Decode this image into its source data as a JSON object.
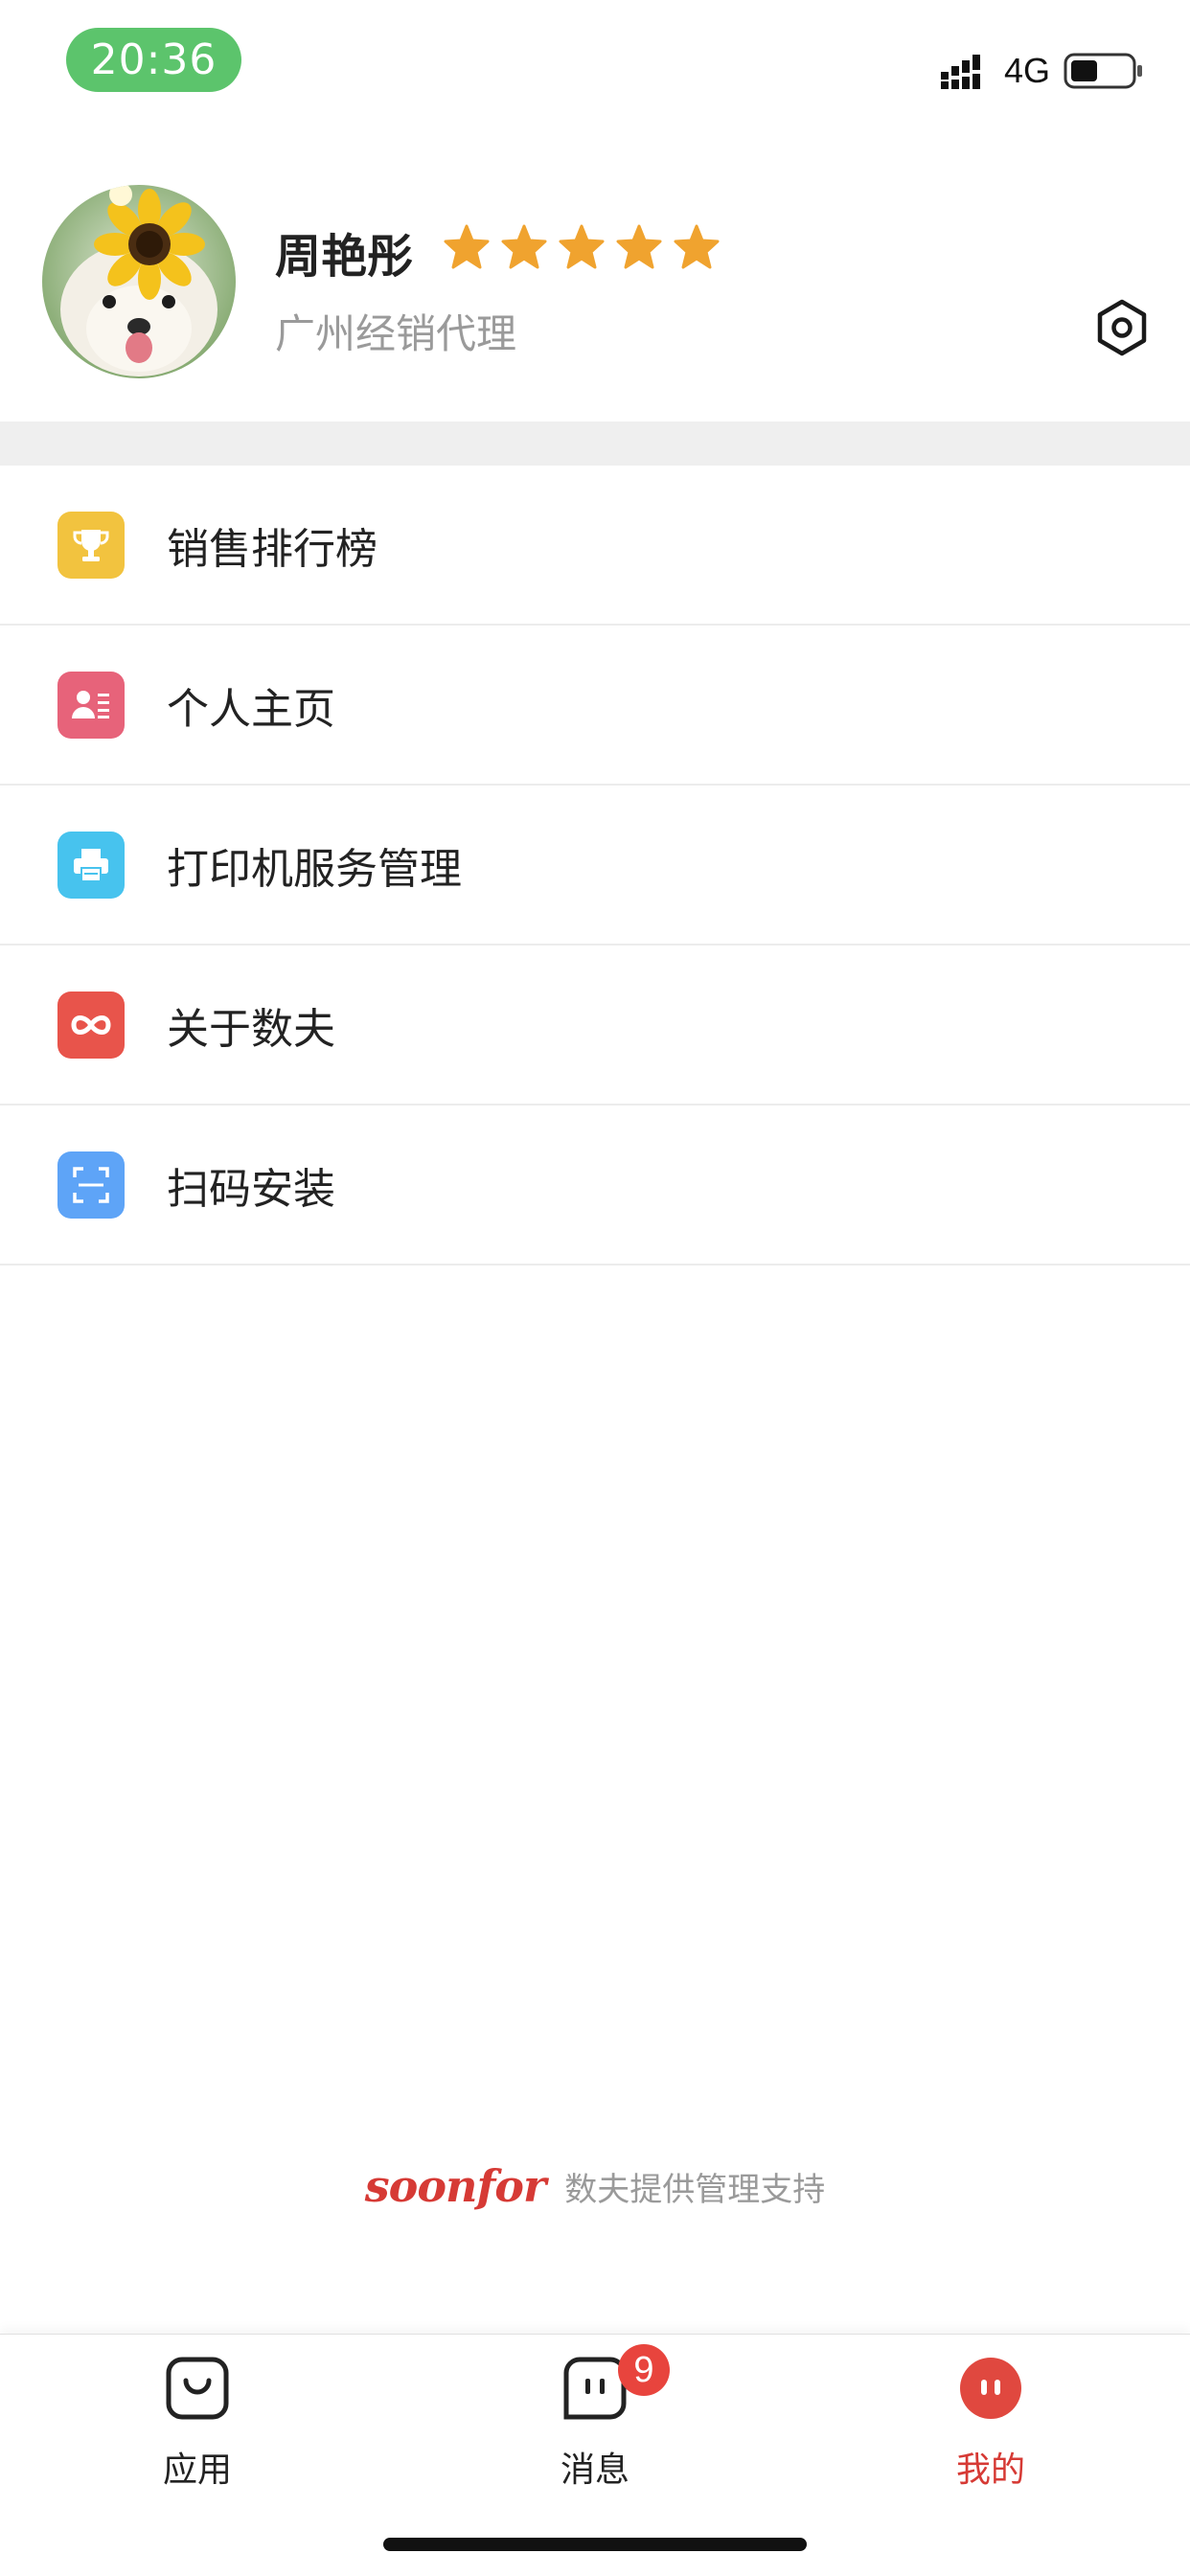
{
  "status_bar": {
    "time": "20:36",
    "network": "4G",
    "battery_level": 0.45
  },
  "profile": {
    "name": "周艳彤",
    "rating": 5,
    "role": "广州经销代理"
  },
  "menu": [
    {
      "label": "销售排行榜",
      "icon": "trophy-icon",
      "color": "#f2c33f"
    },
    {
      "label": "个人主页",
      "icon": "contact-card-icon",
      "color": "#e7637a"
    },
    {
      "label": "打印机服务管理",
      "icon": "printer-icon",
      "color": "#47c3ee"
    },
    {
      "label": "关于数夫",
      "icon": "infinity-icon",
      "color": "#e8544b"
    },
    {
      "label": "扫码安装",
      "icon": "scan-icon",
      "color": "#5ea4f7"
    }
  ],
  "brand": {
    "logo": "soonfor",
    "tagline": "数夫提供管理支持"
  },
  "tabbar": {
    "tabs": [
      {
        "label": "应用",
        "icon": "apps-bag-icon",
        "active": false
      },
      {
        "label": "消息",
        "icon": "message-icon",
        "active": false,
        "badge": "9"
      },
      {
        "label": "我的",
        "icon": "profile-face-icon",
        "active": true
      }
    ]
  },
  "colors": {
    "accent": "#d63a35",
    "star": "#f0a32f",
    "time_pill": "#5cc46c"
  }
}
